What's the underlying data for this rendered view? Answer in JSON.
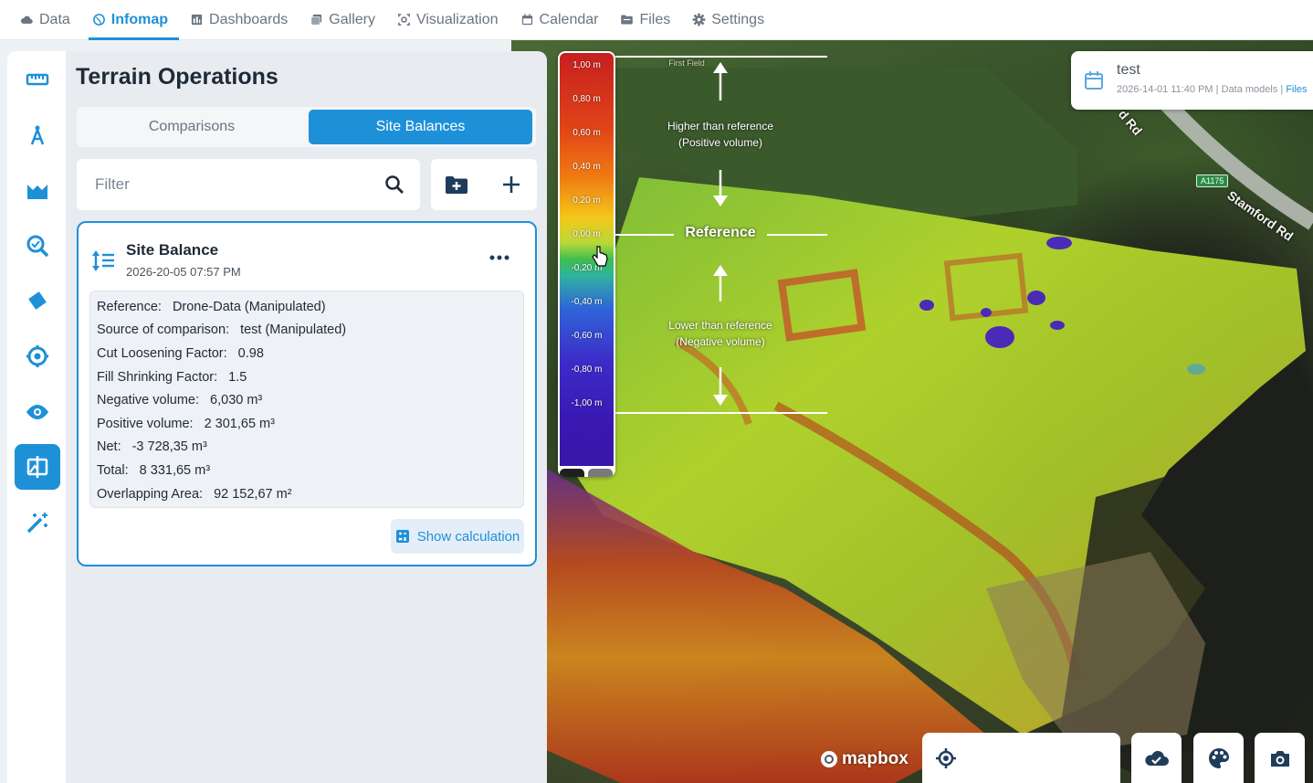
{
  "nav": {
    "items": [
      {
        "label": "Data",
        "icon": "cloud-icon",
        "active": false
      },
      {
        "label": "Infomap",
        "icon": "globe-icon",
        "active": true
      },
      {
        "label": "Dashboards",
        "icon": "dashboard-icon",
        "active": false
      },
      {
        "label": "Gallery",
        "icon": "gallery-icon",
        "active": false
      },
      {
        "label": "Visualization",
        "icon": "visualization-icon",
        "active": false
      },
      {
        "label": "Calendar",
        "icon": "calendar-icon",
        "active": false
      },
      {
        "label": "Files",
        "icon": "folder-icon",
        "active": false
      },
      {
        "label": "Settings",
        "icon": "gear-icon",
        "active": false
      }
    ]
  },
  "rail": {
    "icons": [
      "ruler-icon",
      "compass-icon",
      "terrain-icon",
      "search-map-icon",
      "tag-icon",
      "location-target-icon",
      "eye-icon",
      "compare-icon",
      "magic-wand-icon"
    ],
    "active_index": 7
  },
  "panel": {
    "title": "Terrain Operations",
    "tabs": {
      "comparisons": "Comparisons",
      "site_balances": "Site Balances"
    },
    "filter_placeholder": "Filter"
  },
  "card": {
    "title": "Site Balance",
    "date": "2026-20-05 07:57 PM",
    "details": [
      {
        "key": "Reference:",
        "value": "Drone-Data (Manipulated)"
      },
      {
        "key": "Source of comparison:",
        "value": "test (Manipulated)"
      },
      {
        "key": "Cut Loosening Factor:",
        "value": "0.98"
      },
      {
        "key": "Fill Shrinking Factor:",
        "value": "1.5"
      },
      {
        "key": "Negative volume:",
        "value": "6,030 m³"
      },
      {
        "key": "Positive volume:",
        "value": "2 301,65 m³"
      },
      {
        "key": "Net:",
        "value": "-3 728,35 m³"
      },
      {
        "key": "Total:",
        "value": "8 331,65 m³"
      },
      {
        "key": "Overlapping Area:",
        "value": "92 152,67 m²"
      }
    ],
    "show_calculation": "Show calculation"
  },
  "legend": {
    "ticks": [
      "1,00 m",
      "0,80 m",
      "0,60 m",
      "0,40 m",
      "0,20 m",
      "0,00 m",
      "-0,20 m",
      "-0,40 m",
      "-0,60 m",
      "-0,80 m",
      "-1,00 m"
    ],
    "swatch_colors": [
      "#1f1f1f",
      "#7a7a7a"
    ]
  },
  "annotations": {
    "higher_line1": "Higher than reference",
    "higher_line2": "(Positive volume)",
    "reference": "Reference",
    "lower_line1": "Lower than reference",
    "lower_line2": "(Negative volume)",
    "field_label": "First Field"
  },
  "info_card": {
    "title": "test",
    "timestamp": "2026-14-01 11:40 PM",
    "separator": "|",
    "data_models": "Data models",
    "files": "Files"
  },
  "map": {
    "road_label": "Stamford Rd",
    "road_label_short": "d Rd",
    "road_badge": "A1175",
    "attribution": "mapbox"
  },
  "colors": {
    "accent": "#1e90d8",
    "panel_bg": "#e8ecf0",
    "nav_text": "#6b7480"
  }
}
